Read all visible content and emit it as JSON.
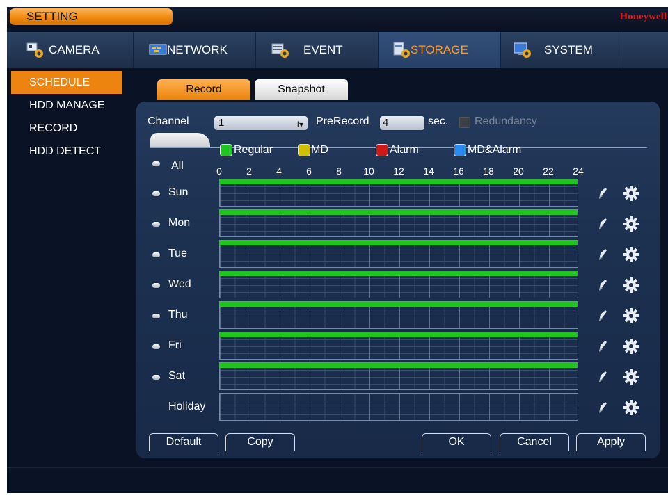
{
  "window": {
    "title": "SETTING",
    "brand": "Honeywell"
  },
  "topnav": [
    {
      "label": "CAMERA",
      "icon": "camera-settings-icon",
      "active": false
    },
    {
      "label": "NETWORK",
      "icon": "network-icon",
      "active": false
    },
    {
      "label": "EVENT",
      "icon": "event-icon",
      "active": false
    },
    {
      "label": "STORAGE",
      "icon": "storage-icon",
      "active": true
    },
    {
      "label": "SYSTEM",
      "icon": "system-icon",
      "active": false
    }
  ],
  "sidebar": {
    "items": [
      {
        "label": "SCHEDULE",
        "active": true
      },
      {
        "label": "HDD MANAGE",
        "active": false
      },
      {
        "label": "RECORD",
        "active": false
      },
      {
        "label": "HDD DETECT",
        "active": false
      }
    ]
  },
  "subtabs": {
    "record": "Record",
    "snapshot": "Snapshot",
    "active": "Record"
  },
  "form": {
    "channel_label": "Channel",
    "channel_value": "1",
    "prerecord_label": "PreRecord",
    "prerecord_value": "4",
    "sec_label": "sec.",
    "redundancy_label": "Redundancy",
    "redundancy_checked": false
  },
  "legend": [
    {
      "label": "Regular",
      "color": "#22c422"
    },
    {
      "label": "MD",
      "color": "#d0c000"
    },
    {
      "label": "Alarm",
      "color": "#d01818"
    },
    {
      "label": "MD&Alarm",
      "color": "#2a8cf0"
    }
  ],
  "all_label": "All",
  "hours": [
    "0",
    "2",
    "4",
    "6",
    "8",
    "10",
    "12",
    "14",
    "16",
    "18",
    "20",
    "22",
    "24"
  ],
  "days": [
    {
      "label": "Sun",
      "regular_start_hour": 0,
      "regular_end_hour": 24
    },
    {
      "label": "Mon",
      "regular_start_hour": 0,
      "regular_end_hour": 24
    },
    {
      "label": "Tue",
      "regular_start_hour": 0,
      "regular_end_hour": 24
    },
    {
      "label": "Wed",
      "regular_start_hour": 0,
      "regular_end_hour": 24
    },
    {
      "label": "Thu",
      "regular_start_hour": 0,
      "regular_end_hour": 24
    },
    {
      "label": "Fri",
      "regular_start_hour": 0,
      "regular_end_hour": 24
    },
    {
      "label": "Sat",
      "regular_start_hour": 0,
      "regular_end_hour": 24
    },
    {
      "label": "Holiday",
      "regular_start_hour": 0,
      "regular_end_hour": 0
    }
  ],
  "buttons": {
    "default": "Default",
    "copy": "Copy",
    "ok": "OK",
    "cancel": "Cancel",
    "apply": "Apply"
  },
  "colors": {
    "accent": "#f08a10",
    "active_nav_text": "#ff9a20",
    "brand": "#e01818"
  }
}
